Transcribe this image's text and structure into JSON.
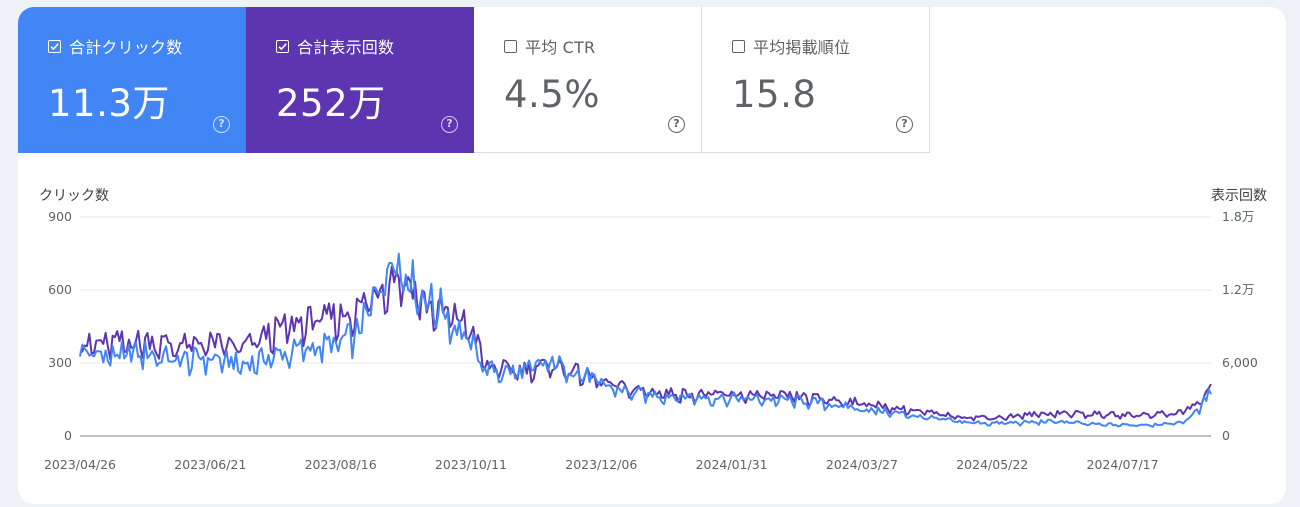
{
  "metrics": [
    {
      "label": "合計クリック数",
      "value": "11.3万",
      "checked": true,
      "color": "#4285f4"
    },
    {
      "label": "合計表示回数",
      "value": "252万",
      "checked": true,
      "color": "#5e35b1"
    },
    {
      "label": "平均 CTR",
      "value": "4.5%",
      "checked": false,
      "color": "#ffffff"
    },
    {
      "label": "平均掲載順位",
      "value": "15.8",
      "checked": false,
      "color": "#ffffff"
    }
  ],
  "help_icon": "question-circle-icon",
  "chart_data": {
    "type": "line",
    "ylabel_left": "クリック数",
    "ylabel_right": "表示回数",
    "y_left_ticks": [
      "0",
      "300",
      "600",
      "900"
    ],
    "y_left_range": [
      0,
      900
    ],
    "y_right_ticks": [
      "0",
      "6,000",
      "1.2万",
      "1.8万"
    ],
    "y_right_range": [
      0,
      18000
    ],
    "x_ticks": [
      "2023/04/26",
      "2023/06/21",
      "2023/08/16",
      "2023/10/11",
      "2023/12/06",
      "2024/01/31",
      "2024/03/27",
      "2024/05/22",
      "2024/07/17"
    ],
    "x_range": [
      "2023/04/26",
      "2024/08/24"
    ],
    "grid": true,
    "series": [
      {
        "name": "合計クリック数",
        "axis": "left",
        "color": "#4285f4",
        "dates": [
          "2023-04-26",
          "2023-05-10",
          "2023-05-24",
          "2023-06-07",
          "2023-06-21",
          "2023-07-05",
          "2023-07-19",
          "2023-08-02",
          "2023-08-16",
          "2023-08-24",
          "2023-09-01",
          "2023-09-08",
          "2023-09-15",
          "2023-09-22",
          "2023-09-29",
          "2023-10-06",
          "2023-10-11",
          "2023-10-18",
          "2023-11-01",
          "2023-11-15",
          "2023-11-29",
          "2023-12-06",
          "2023-12-20",
          "2024-01-03",
          "2024-01-17",
          "2024-01-31",
          "2024-02-14",
          "2024-02-28",
          "2024-03-13",
          "2024-03-27",
          "2024-04-10",
          "2024-04-24",
          "2024-05-08",
          "2024-05-22",
          "2024-06-05",
          "2024-06-19",
          "2024-07-03",
          "2024-07-17",
          "2024-07-31",
          "2024-08-10",
          "2024-08-17",
          "2024-08-24"
        ],
        "values": [
          345,
          330,
          340,
          310,
          320,
          290,
          330,
          360,
          380,
          430,
          600,
          750,
          640,
          560,
          520,
          430,
          380,
          270,
          260,
          300,
          250,
          210,
          175,
          165,
          158,
          155,
          150,
          145,
          130,
          110,
          95,
          75,
          58,
          52,
          55,
          60,
          48,
          45,
          48,
          52,
          90,
          180
        ]
      },
      {
        "name": "合計表示回数",
        "axis": "right",
        "color": "#5e35b1",
        "dates": [
          "2023-04-26",
          "2023-05-10",
          "2023-05-24",
          "2023-06-07",
          "2023-06-21",
          "2023-07-05",
          "2023-07-19",
          "2023-08-02",
          "2023-08-16",
          "2023-08-24",
          "2023-09-01",
          "2023-09-08",
          "2023-09-15",
          "2023-09-22",
          "2023-09-29",
          "2023-10-06",
          "2023-10-11",
          "2023-10-18",
          "2023-11-01",
          "2023-11-15",
          "2023-11-29",
          "2023-12-06",
          "2023-12-20",
          "2024-01-03",
          "2024-01-17",
          "2024-01-31",
          "2024-02-14",
          "2024-02-28",
          "2024-03-13",
          "2024-03-27",
          "2024-04-10",
          "2024-04-24",
          "2024-05-08",
          "2024-05-22",
          "2024-06-05",
          "2024-06-19",
          "2024-07-03",
          "2024-07-17",
          "2024-07-31",
          "2024-08-10",
          "2024-08-17",
          "2024-08-24"
        ],
        "values": [
          7400,
          7600,
          7800,
          7400,
          7600,
          7200,
          8600,
          9400,
          9800,
          10400,
          12000,
          13200,
          12400,
          10600,
          10000,
          9600,
          8800,
          5600,
          5400,
          5800,
          5000,
          4400,
          3800,
          3500,
          3400,
          3400,
          3300,
          3200,
          3000,
          2700,
          2300,
          1900,
          1600,
          1500,
          1700,
          1900,
          1800,
          1700,
          1800,
          1900,
          2500,
          3800
        ]
      }
    ]
  }
}
